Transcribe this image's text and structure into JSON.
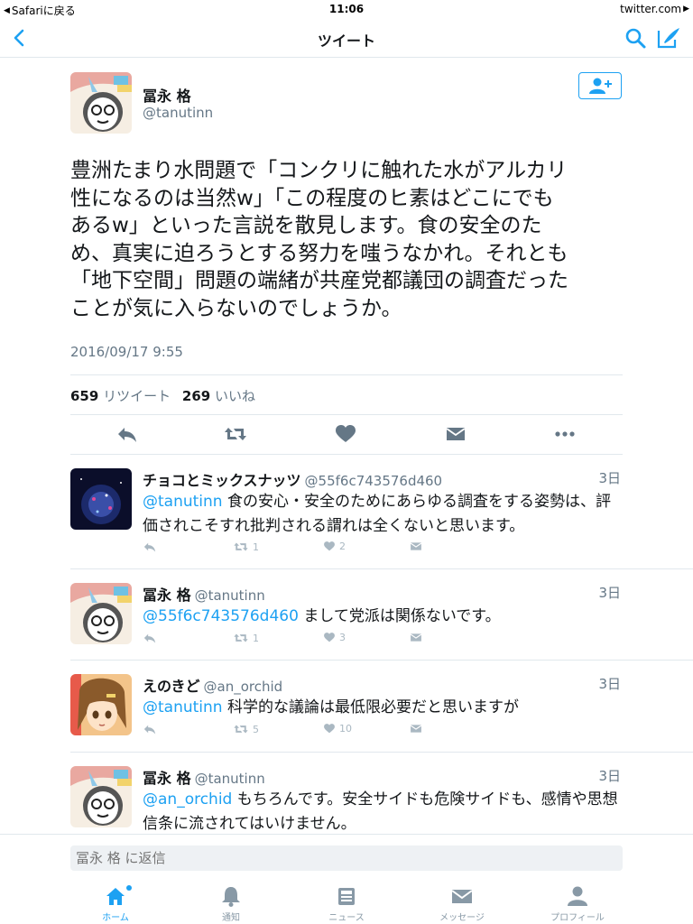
{
  "status_bar": {
    "back_app": "Safariに戻る",
    "time": "11:06",
    "domain": "twitter.com"
  },
  "nav": {
    "title": "ツイート"
  },
  "main_tweet": {
    "name": "冨永 格",
    "handle": "@tanutinn",
    "text_lines": [
      "豊洲たまり水問題で「コンクリに触れた水がアルカリ",
      "性になるのは当然w」「この程度のヒ素はどこにでも",
      "あるw」といった言説を散見します。食の安全のた",
      "め、真実に迫ろうとする努力を嗤うなかれ。それとも",
      "「地下空間」問題の端緒が共産党都議団の調査だった",
      "ことが気に入らないのでしょうか。"
    ],
    "date": "2016/09/17 9:55",
    "retweet_count": "659",
    "retweet_label": "リツイート",
    "like_count": "269",
    "like_label": "いいね"
  },
  "replies": [
    {
      "name": "チョコとミックスナッツ",
      "handle": "@55f6c743576d460",
      "time": "3日",
      "mention": "@tanutinn",
      "text": " 食の安心・安全のためにあらゆる調査をする姿勢は、評価されこそすれ批判される謂れは全くないと思います。",
      "retweets": "1",
      "likes": "2"
    },
    {
      "name": "冨永 格",
      "handle": "@tanutinn",
      "time": "3日",
      "mention": "@55f6c743576d460",
      "text": " まして党派は関係ないです。",
      "retweets": "1",
      "likes": "3"
    },
    {
      "name": "えのきど",
      "handle": "@an_orchid",
      "time": "3日",
      "mention": "@tanutinn",
      "text": " 科学的な議論は最低限必要だと思いますが",
      "retweets": "5",
      "likes": "10"
    },
    {
      "name": "冨永 格",
      "handle": "@tanutinn",
      "time": "3日",
      "mention": "@an_orchid",
      "text": " もちろんです。安全サイドも危険サイドも、感情や思想信条に流されてはいけません。",
      "retweets": "",
      "likes": ""
    }
  ],
  "reply_box": {
    "placeholder": "冨永 格 に返信"
  },
  "tabs": [
    {
      "label": "ホーム",
      "icon": "home-icon"
    },
    {
      "label": "通知",
      "icon": "bell-icon"
    },
    {
      "label": "ニュース",
      "icon": "news-icon"
    },
    {
      "label": "メッセージ",
      "icon": "envelope-icon"
    },
    {
      "label": "プロフィール",
      "icon": "person-icon"
    }
  ],
  "colors": {
    "accent": "#1da1f2",
    "secondary_text": "#657786",
    "icon_gray": "#aab8c2"
  }
}
